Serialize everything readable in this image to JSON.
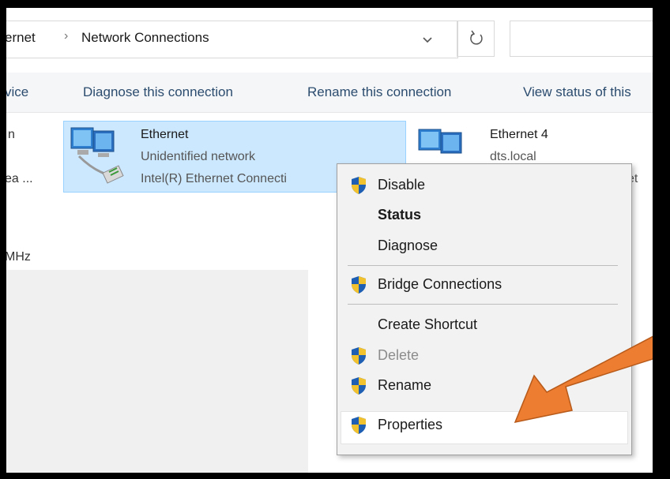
{
  "address_bar": {
    "crumb_prev": "ernet",
    "crumb_current": "Network Connections",
    "separator": "›",
    "dropdown_glyph": "⌄"
  },
  "command_bar": {
    "item_partial": "vice",
    "diagnose": "Diagnose this connection",
    "rename": "Rename this connection",
    "view_status": "View status of this"
  },
  "left_column": {
    "line1": "n",
    "line2": "ea ...",
    "line3": "MHz"
  },
  "connections": [
    {
      "name": "Ethernet",
      "status": "Unidentified network",
      "adapter": "Intel(R) Ethernet Connecti",
      "icon": "network-adapter-icon"
    },
    {
      "name": "Ethernet 4",
      "status": "dts.local",
      "adapter": "et",
      "icon": "network-adapter-icon"
    }
  ],
  "context_menu": {
    "items": [
      {
        "label": "Disable",
        "icon": "uac-shield-icon",
        "style": "normal"
      },
      {
        "label": "Status",
        "icon": "",
        "style": "bold"
      },
      {
        "label": "Diagnose",
        "icon": "",
        "style": "normal"
      },
      {
        "label": "Bridge Connections",
        "icon": "uac-shield-icon",
        "style": "normal"
      },
      {
        "label": "Create Shortcut",
        "icon": "",
        "style": "normal"
      },
      {
        "label": "Delete",
        "icon": "uac-shield-icon",
        "style": "disabled"
      },
      {
        "label": "Rename",
        "icon": "uac-shield-icon",
        "style": "normal"
      },
      {
        "label": "Properties",
        "icon": "uac-shield-icon",
        "style": "highlighted"
      }
    ]
  },
  "annotation": {
    "icon": "orange-arrow-icon",
    "color": "#ed7d31"
  },
  "colors": {
    "selection": "#cce8ff",
    "selection_border": "#99d1ff",
    "link": "#2b4c6f",
    "shield_blue": "#1e5fb3",
    "shield_yellow": "#f2c12e"
  }
}
